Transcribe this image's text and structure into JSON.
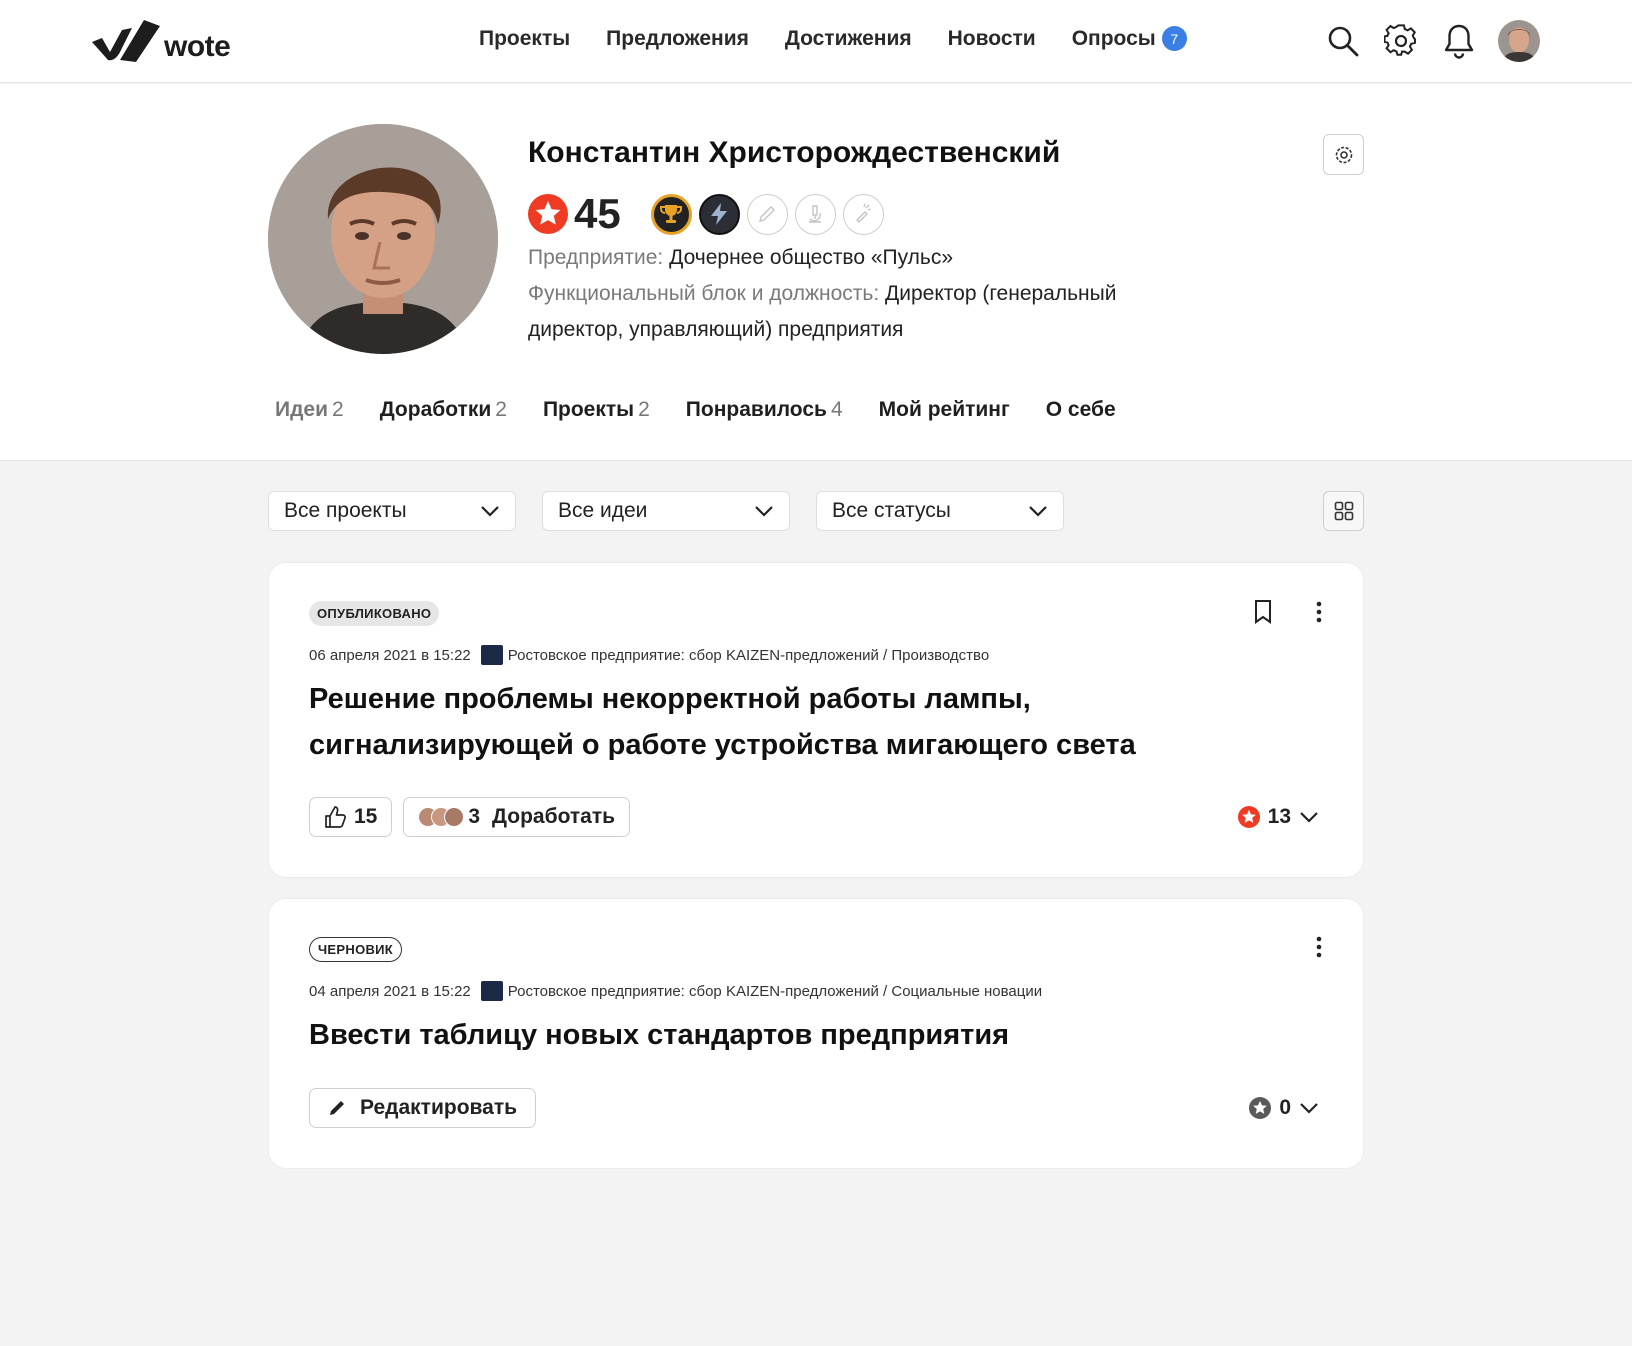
{
  "app": {
    "logo_text": "wote"
  },
  "nav": {
    "items": [
      "Проекты",
      "Предложения",
      "Достижения",
      "Новости",
      "Опросы"
    ],
    "surveys_count": "7"
  },
  "profile": {
    "name": "Константин Христорождественский",
    "rating": "45",
    "company_label": "Предприятие:",
    "company_value": "Дочернее общество «Пульс»",
    "position_label": "Функциональный блок и должность:",
    "position_value_1": "Директор (генеральный",
    "position_value_2": "директор, управляющий) предприятия"
  },
  "tabs": [
    {
      "label": "Идеи",
      "count": "2"
    },
    {
      "label": "Доработки",
      "count": "2"
    },
    {
      "label": "Проекты",
      "count": "2"
    },
    {
      "label": "Понравилось",
      "count": "4"
    },
    {
      "label": "Мой рейтинг",
      "count": ""
    },
    {
      "label": "О себе",
      "count": ""
    }
  ],
  "filters": {
    "projects": "Все проекты",
    "ideas": "Все идеи",
    "statuses": "Все статусы"
  },
  "cards": [
    {
      "status": "ОПУБЛИКОВАНО",
      "date": "06 апреля 2021 в 15:22",
      "project": "Ростовское предприятие: сбор KAIZEN-предложений / Производство",
      "title_1": "Решение проблемы некорректной работы лампы,",
      "title_2": "сигнализирующей о работе устройства мигающего света",
      "likes": "15",
      "improve_count": "3",
      "improve_label": "Доработать",
      "score": "13"
    },
    {
      "status": "ЧЕРНОВИК",
      "date": "04 апреля 2021 в 15:22",
      "project": "Ростовское предприятие: сбор KAIZEN-предложений / Социальные новации",
      "title_1": "Ввести таблицу новых стандартов предприятия",
      "edit_label": "Редактировать",
      "score": "0"
    }
  ],
  "colors": {
    "accent_red": "#ef3b24",
    "badge_blue": "#3b7ee6",
    "gold": "#e8a326"
  }
}
